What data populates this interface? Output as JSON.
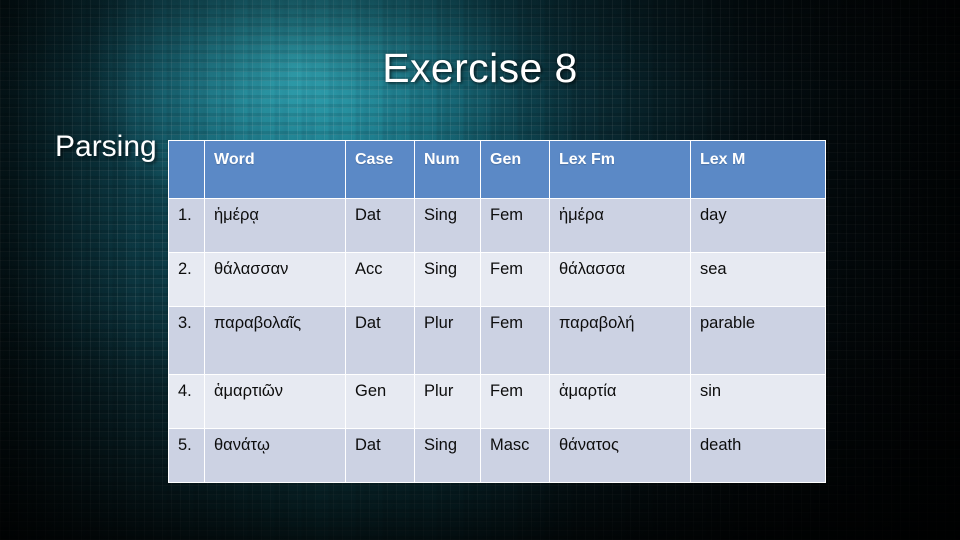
{
  "slide": {
    "title": "Exercise 8",
    "section_label": "Parsing",
    "accent_header_color": "#5b89c6",
    "row_dark_color": "#ccd2e3",
    "row_light_color": "#e7eaf2",
    "background_color": "#06171b"
  },
  "table": {
    "headers": {
      "num": "",
      "word": "Word",
      "case": "Case",
      "number": "Num",
      "gender": "Gen",
      "lex_fm": "Lex Fm",
      "lex_m": "Lex M"
    },
    "rows": [
      {
        "num": "1.",
        "word": "ἡμέρᾳ",
        "case": "Dat",
        "number": "Sing",
        "gender": "Fem",
        "lex_fm": "ἡμέρα",
        "lex_m": "day"
      },
      {
        "num": "2.",
        "word": "θάλασσαν",
        "case": "Acc",
        "number": "Sing",
        "gender": "Fem",
        "lex_fm": "θάλασσα",
        "lex_m": "sea"
      },
      {
        "num": "3.",
        "word": "παραβολαῖς",
        "case": "Dat",
        "number": "Plur",
        "gender": "Fem",
        "lex_fm": "παραβολή",
        "lex_m": "parable"
      },
      {
        "num": "4.",
        "word": "ἁμαρτιῶν",
        "case": "Gen",
        "number": "Plur",
        "gender": "Fem",
        "lex_fm": "ἁμαρτία",
        "lex_m": "sin"
      },
      {
        "num": "5.",
        "word": "θανάτῳ",
        "case": "Dat",
        "number": "Sing",
        "gender": "Masc",
        "lex_fm": "θάνατος",
        "lex_m": "death"
      }
    ]
  }
}
